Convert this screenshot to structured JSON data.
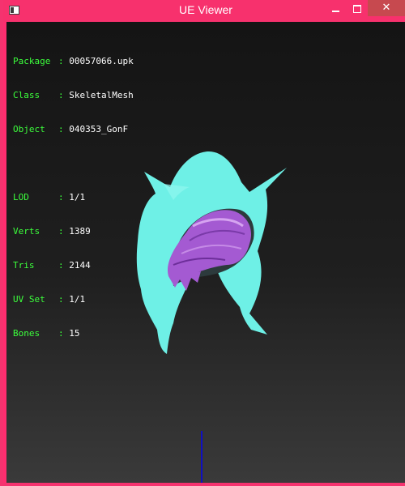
{
  "window": {
    "title": "UE Viewer",
    "close_glyph": "✕"
  },
  "info": {
    "package": {
      "key": "Package",
      "value": "00057066.upk"
    },
    "class": {
      "key": "Class",
      "value": "SkeletalMesh"
    },
    "object": {
      "key": "Object",
      "value": "040353_GonF"
    },
    "lod": {
      "key": "LOD",
      "value": "1/1"
    },
    "verts": {
      "key": "Verts",
      "value": "1389"
    },
    "tris": {
      "key": "Tris",
      "value": "2144"
    },
    "uvset": {
      "key": "UV Set",
      "value": "1/1"
    },
    "bones": {
      "key": "Bones",
      "value": "15"
    }
  },
  "icons": {
    "app": "app-icon",
    "minimize": "minimize-icon",
    "maximize": "maximize-icon",
    "close": "close-icon"
  },
  "colors": {
    "titlebar": "#f7316d",
    "close_button": "#c7494f",
    "label_text": "#3cff3c",
    "value_text": "#ffffff",
    "mesh_hood": "#6ef0e6",
    "mesh_hair": "#a45ad2",
    "axis": "#1010c0"
  }
}
